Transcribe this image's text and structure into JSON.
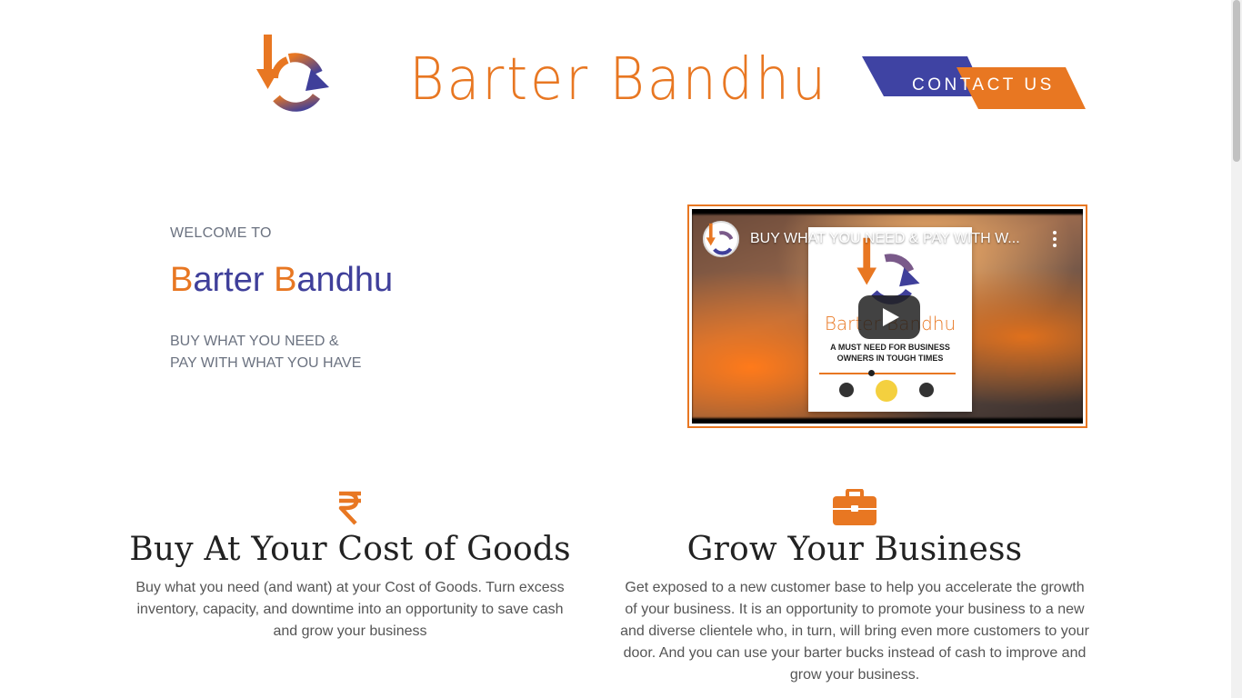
{
  "header": {
    "brand": "Barter Bandhu",
    "contact_label": "CONTACT US",
    "colors": {
      "accent_orange": "#e87722",
      "accent_indigo": "#3f3f9a"
    }
  },
  "hero": {
    "welcome": "WELCOME TO",
    "title_first_initial": "B",
    "title_first_rest": "arter ",
    "title_second_initial": "B",
    "title_second_rest": "andhu",
    "tagline_line1": "BUY WHAT YOU NEED &",
    "tagline_line2": "PAY WITH WHAT YOU HAVE"
  },
  "video": {
    "title": "BUY WHAT YOU NEED & PAY WITH W...",
    "card_brand": "Barter Bandhu",
    "card_sub_line1": "A MUST NEED FOR BUSINESS",
    "card_sub_line2": "OWNERS IN TOUGH TIMES",
    "icons": [
      "channel-avatar-icon",
      "more-options-icon",
      "play-icon"
    ]
  },
  "features": [
    {
      "icon": "rupee-icon",
      "title": "Buy At Your Cost of Goods",
      "text": "Buy what you need (and want) at your Cost of Goods. Turn excess inventory, capacity, and downtime into an opportunity to save cash and grow your business"
    },
    {
      "icon": "briefcase-icon",
      "title": "Grow Your Business",
      "text": "Get exposed to a new customer base to help you accelerate the growth of your business. It is an opportunity to promote your business to a new and diverse clientele who, in turn, will bring even more customers to your door. And you can use your barter bucks instead of cash to improve and grow your business."
    }
  ]
}
